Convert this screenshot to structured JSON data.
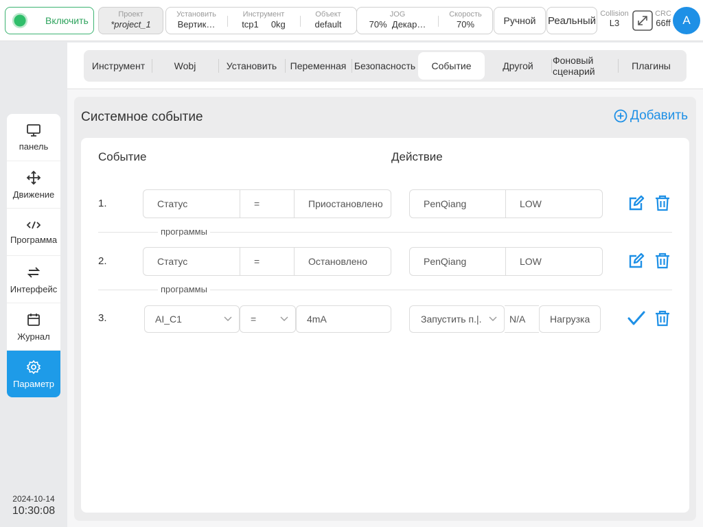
{
  "topbar": {
    "power_label": "Включить",
    "project": {
      "key": "Проект",
      "value": "*project_1"
    },
    "install": {
      "key": "Установить",
      "value": "Вертик…"
    },
    "tool": {
      "key": "Инструмент",
      "value_a": "tcp1",
      "value_b": "0kg"
    },
    "object": {
      "key": "Объект",
      "value": "default"
    },
    "jog": {
      "key": "JOG",
      "value_a": "70%",
      "value_b": "Декар…"
    },
    "speed": {
      "key": "Скорость",
      "value": "70%"
    },
    "mode_label": "Ручной",
    "real_label": "Реальный",
    "collision": {
      "key": "Collision",
      "value": "L3"
    },
    "crc": {
      "key": "CRC",
      "value": "66ff"
    },
    "avatar_letter": "A"
  },
  "sidebar": {
    "items": [
      {
        "label": "панель",
        "icon": "monitor-icon"
      },
      {
        "label": "Движение",
        "icon": "move-icon"
      },
      {
        "label": "Программа",
        "icon": "code-icon"
      },
      {
        "label": "Интерфейс",
        "icon": "swap-icon"
      },
      {
        "label": "Журнал",
        "icon": "calendar-icon"
      },
      {
        "label": "Параметр",
        "icon": "gear-icon"
      }
    ],
    "date": "2024-10-14",
    "time": "10:30:08"
  },
  "tabs": [
    "Инструмент",
    "Wobj",
    "Установить",
    "Переменная",
    "Безопасность",
    "Событие",
    "Другой",
    "Фоновый сценарий",
    "Плагины"
  ],
  "active_tab": "Событие",
  "main": {
    "title": "Системное событие",
    "add_label": "Добавить",
    "col_event": "Событие",
    "col_action": "Действие",
    "rows": [
      {
        "num": "1.",
        "cond": "Статус",
        "op": "=",
        "val": "Приостановлено",
        "cont": "программы",
        "act": "PenQiang",
        "level": "LOW"
      },
      {
        "num": "2.",
        "cond": "Статус",
        "op": "=",
        "val": "Остановлено",
        "cont": "программы",
        "act": "PenQiang",
        "level": "LOW"
      }
    ],
    "edit_row": {
      "num": "3.",
      "cond": "AI_C1",
      "op": "=",
      "val": "4mA",
      "act": "Запустить п.|.",
      "na": "N/A",
      "load": "Нагрузка"
    }
  },
  "colors": {
    "accent": "#1e90e6",
    "power": "#2fbe6a",
    "active_side": "#1e9be8"
  }
}
